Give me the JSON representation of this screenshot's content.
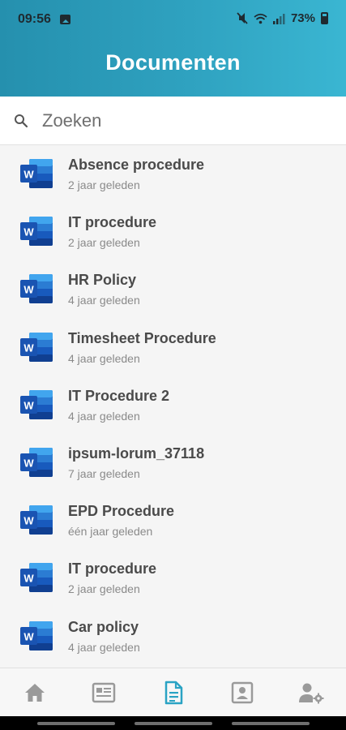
{
  "status_bar": {
    "time": "09:56",
    "battery": "73%",
    "icons": [
      "photo-icon",
      "mute-icon",
      "wifi-icon",
      "signal-icon",
      "battery-icon"
    ]
  },
  "header": {
    "title": "Documenten"
  },
  "search": {
    "placeholder": "Zoeken",
    "value": ""
  },
  "documents": [
    {
      "title": "Absence procedure",
      "date": "2 jaar geleden",
      "icon": "word-icon"
    },
    {
      "title": "IT procedure",
      "date": "2 jaar geleden",
      "icon": "word-icon"
    },
    {
      "title": "HR Policy",
      "date": "4 jaar geleden",
      "icon": "word-icon"
    },
    {
      "title": "Timesheet Procedure",
      "date": "4 jaar geleden",
      "icon": "word-icon"
    },
    {
      "title": "IT Procedure 2",
      "date": "4 jaar geleden",
      "icon": "word-icon"
    },
    {
      "title": "ipsum-lorum_37118",
      "date": "7 jaar geleden",
      "icon": "word-icon"
    },
    {
      "title": "EPD Procedure",
      "date": "één jaar geleden",
      "icon": "word-icon"
    },
    {
      "title": "IT procedure",
      "date": "2 jaar geleden",
      "icon": "word-icon"
    },
    {
      "title": "Car policy",
      "date": "4 jaar geleden",
      "icon": "word-icon"
    }
  ],
  "bottom_nav": {
    "items": [
      {
        "icon": "home-icon",
        "active": false
      },
      {
        "icon": "news-icon",
        "active": false
      },
      {
        "icon": "document-icon",
        "active": true
      },
      {
        "icon": "contact-card-icon",
        "active": false
      },
      {
        "icon": "user-settings-icon",
        "active": false
      }
    ],
    "active_color": "#2aa3c4",
    "inactive_color": "#9a9a9a"
  },
  "colors": {
    "header_start": "#2590ae",
    "header_end": "#3ab6d2",
    "word_blue": "#185abd"
  }
}
